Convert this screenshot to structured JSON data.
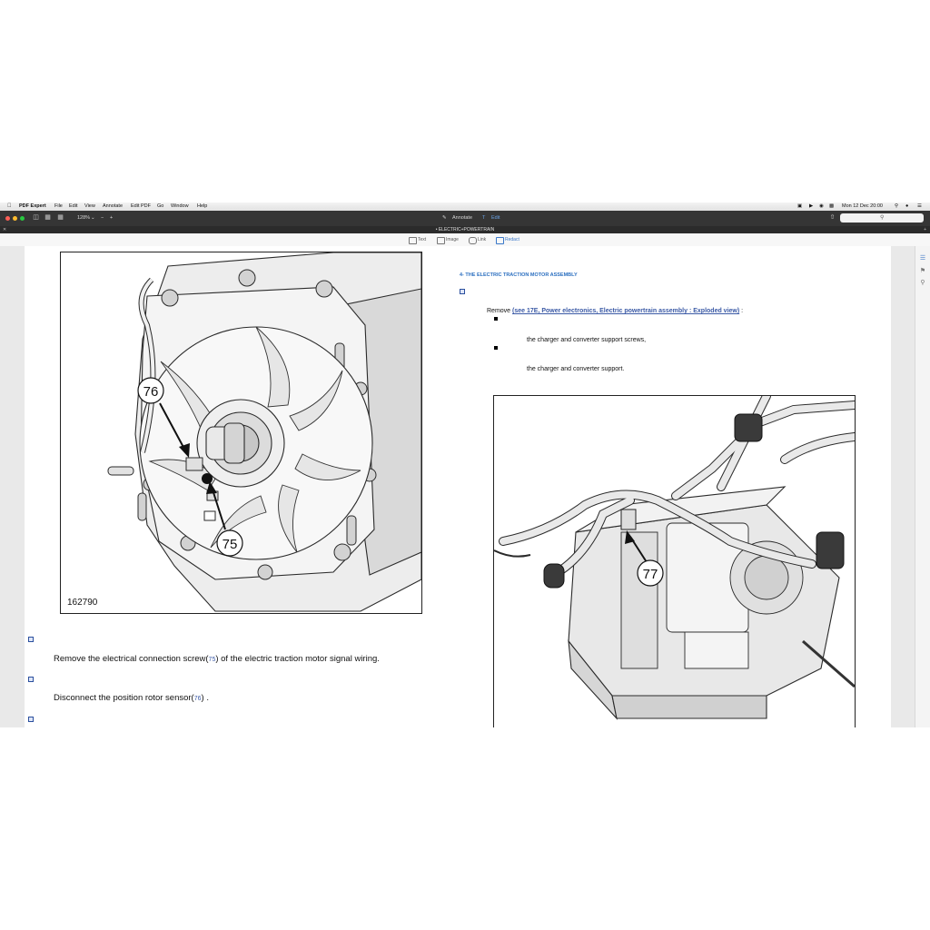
{
  "menubar": {
    "app_name": "PDF Expert",
    "items": [
      "File",
      "Edit",
      "View",
      "Annotate",
      "Edit PDF",
      "Go",
      "Window",
      "Help"
    ],
    "datetime": "Mon 12 Dec  20:00"
  },
  "toolbar": {
    "zoom": "128%",
    "annotate_label": "Annotate",
    "edit_label": "Edit"
  },
  "tab": {
    "title": "• ELECTRIC+POWERTRAIN"
  },
  "edit_tools": {
    "text": "Text",
    "image": "Image",
    "link": "Link",
    "redact": "Redact"
  },
  "document": {
    "left_figure_id": "162790",
    "callout_76": "76",
    "callout_75": "75",
    "callout_77": "77",
    "step1_a": "Remove the electrical connection screw(",
    "step1_ref": "75",
    "step1_b": ") of the electric traction motor signal wiring.",
    "step2_a": "Disconnect the position rotor sensor(",
    "step2_ref": "76",
    "step2_b": ") .",
    "heading": "4- THE ELECTRIC TRACTION MOTOR ASSEMBLY",
    "remove_label": "Remove",
    "remove_link": "(see 17E, Power electronics, Electric powertrain assembly : Exploded view)",
    "remove_suffix": " :",
    "item1": "the charger and converter support screws,",
    "item2": "the charger and converter support."
  },
  "colors": {
    "toolbar_bg": "#353535",
    "accent": "#3a78c9",
    "heading": "#2b6fc0",
    "link": "#3b5aa6"
  }
}
